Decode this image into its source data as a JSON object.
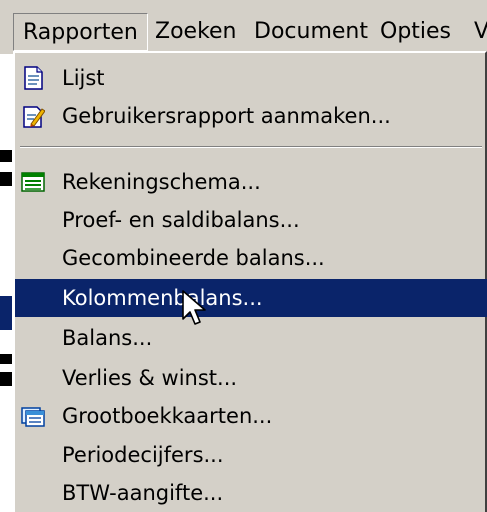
{
  "menubar": {
    "items": [
      {
        "label": "Rapporten"
      },
      {
        "label": "Zoeken"
      },
      {
        "label": "Document"
      },
      {
        "label": "Opties"
      },
      {
        "label": "V"
      }
    ]
  },
  "menu": {
    "items": [
      {
        "label": "Lijst",
        "icon": "document-list-icon"
      },
      {
        "label": "Gebruikersrapport aanmaken...",
        "icon": "edit-report-icon"
      },
      {
        "label": "Rekeningschema...",
        "icon": "chart-of-accounts-icon"
      },
      {
        "label": "Proef- en saldibalans..."
      },
      {
        "label": "Gecombineerde balans..."
      },
      {
        "label": "Kolommenbalans...",
        "selected": true
      },
      {
        "label": "Balans..."
      },
      {
        "label": "Verlies & winst..."
      },
      {
        "label": "Grootboekkaarten...",
        "icon": "ledger-cards-icon"
      },
      {
        "label": "Periodecijfers..."
      },
      {
        "label": "BTW-aangifte..."
      }
    ]
  },
  "colors": {
    "menu_bg": "#d4d0c8",
    "selection_bg": "#0a246a",
    "selection_fg": "#ffffff"
  }
}
